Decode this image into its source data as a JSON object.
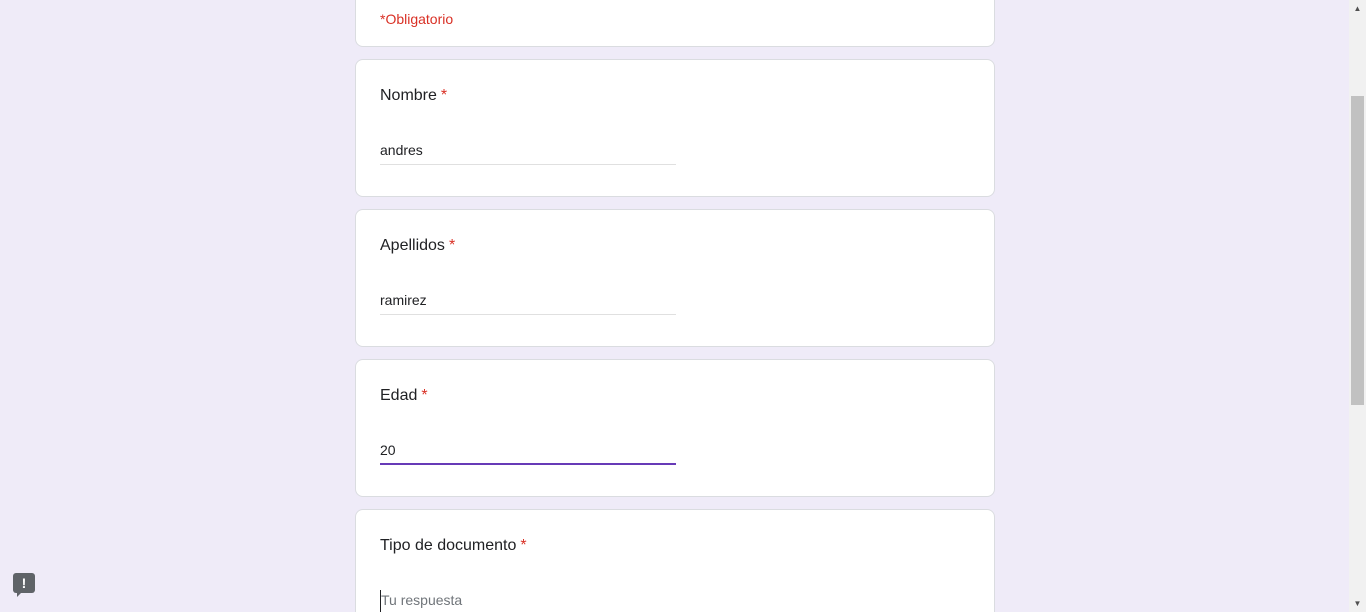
{
  "form": {
    "required_note": "*Obligatorio",
    "required_marker": "*",
    "questions": [
      {
        "label": "Nombre",
        "value": "andres"
      },
      {
        "label": "Apellidos",
        "value": "ramirez"
      },
      {
        "label": "Edad",
        "value": "20"
      },
      {
        "label": "Tipo de documento",
        "placeholder": "Tu respuesta"
      }
    ]
  },
  "icons": {
    "feedback": "feedback-icon",
    "scroll_up": "▲",
    "scroll_down": "▼"
  },
  "colors": {
    "background": "#efebf8",
    "accent": "#673ab7",
    "required": "#d93025"
  }
}
